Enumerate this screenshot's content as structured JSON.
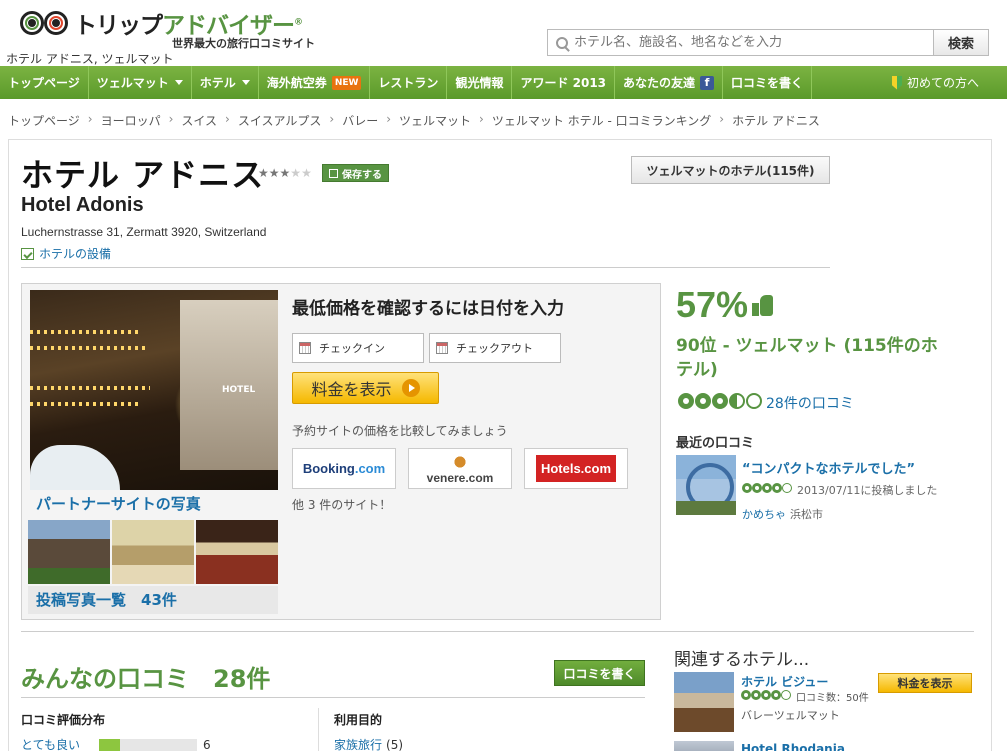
{
  "header": {
    "logo_main": "トリップ",
    "logo_accent": "アドバイザー",
    "logo_reg": "®",
    "tagline": "世界最大の旅行口コミサイト",
    "geo_label": "ホテル アドニス, ツェルマット",
    "search_placeholder": "ホテル名、施設名、地名などを入力",
    "search_button": "検索"
  },
  "nav": {
    "items": [
      {
        "label": "トップページ"
      },
      {
        "label": "ツェルマット"
      },
      {
        "label": "ホテル"
      },
      {
        "label": "海外航空券",
        "badge": "NEW"
      },
      {
        "label": "レストラン"
      },
      {
        "label": "観光情報"
      },
      {
        "label": "アワード 2013"
      },
      {
        "label": "あなたの友達",
        "icon": "facebook-icon"
      },
      {
        "label": "口コミを書く"
      }
    ],
    "first_time": "初めての方へ"
  },
  "breadcrumb": [
    "トップページ",
    "ヨーロッパ",
    "スイス",
    "スイスアルプス",
    "バレー",
    "ツェルマット",
    "ツェルマット ホテル - 口コミランキング",
    "ホテル アドニス"
  ],
  "hotel": {
    "name_ja": "ホテル アドニス",
    "name_en": "Hotel Adonis",
    "address": "Luchernstrasse 31, Zermatt 3920, Switzerland",
    "amenities_link": "ホテルの設備",
    "save_label": "保存する",
    "city_hotels_button": "ツェルマットのホテル(115件)",
    "star_rating": 3,
    "photo_sign": "HOTEL"
  },
  "booking": {
    "prompt": "最低価格を確認するには日付を入力",
    "checkin": "チェックイン",
    "checkout": "チェックアウト",
    "show_price": "料金を表示",
    "compare_label": "予約サイトの価格を比較してみましょう",
    "partners": {
      "booking_name": "Booking",
      "booking_suffix": ".com",
      "venere": "venere.com",
      "hotels": "Hotels.com"
    },
    "more_sites": "他 3 件のサイト！",
    "partner_photos": "パートナーサイトの写真",
    "gallery": "投稿写真一覧　43件"
  },
  "rating": {
    "percent": "57%",
    "rank": "90位 - ツェルマット (115件のホテル)",
    "bubbles": 3.5,
    "review_count": "28件の口コミ",
    "recent_title": "最近の口コミ",
    "recent_quote": "“コンパクトなホテルでした”",
    "recent_bubbles": 4,
    "recent_date": "2013/07/11に投稿しました",
    "reviewer_name": "かめちゃ",
    "reviewer_location": "浜松市"
  },
  "reviews": {
    "heading": "みんなの口コミ　28件",
    "write_button": "口コミを書く",
    "distribution_title": "口コミ評価分布",
    "distribution": [
      {
        "label": "とても良い",
        "count": "6",
        "fraction": 0.21
      }
    ],
    "purpose_title": "利用目的",
    "purposes": [
      {
        "label": "家族旅行",
        "count": "(5)"
      }
    ]
  },
  "related": {
    "title": "関連するホテル...",
    "items": [
      {
        "name": "ホテル ビジュー",
        "bubbles": 4,
        "count": "口コミ数：50件",
        "location": "バレーツェルマット",
        "price_button": "料金を表示"
      },
      {
        "name": "Hotel Rhodania"
      }
    ]
  },
  "colors": {
    "brand_green": "#589442",
    "nav_green": "#6aa836",
    "link_blue": "#1a6fa8",
    "price_yellow": "#f5b800"
  }
}
